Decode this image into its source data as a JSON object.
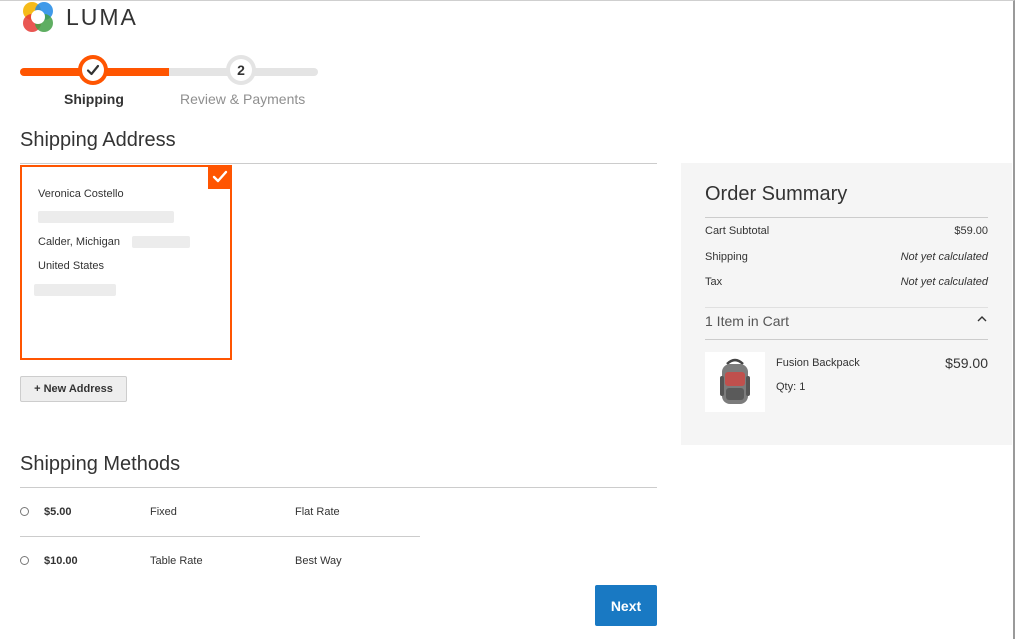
{
  "brand": {
    "name": "LUMA"
  },
  "progress": {
    "steps": [
      {
        "label": "Shipping",
        "number": "1",
        "state": "complete"
      },
      {
        "label": "Review & Payments",
        "number": "2",
        "state": "pending"
      }
    ],
    "completed_fraction": 0.5
  },
  "shipping_address": {
    "title": "Shipping Address",
    "selected_card": {
      "name": "Veronica Costello",
      "street": "",
      "city_line": "Calder, Michigan",
      "country": "United States",
      "phone": ""
    },
    "new_address_label": "+ New Address"
  },
  "shipping_methods": {
    "title": "Shipping Methods",
    "options": [
      {
        "price": "$5.00",
        "carrier": "Fixed",
        "method": "Flat Rate",
        "selected": false
      },
      {
        "price": "$10.00",
        "carrier": "Table Rate",
        "method": "Best Way",
        "selected": false
      }
    ],
    "next_label": "Next"
  },
  "order_summary": {
    "title": "Order Summary",
    "totals": [
      {
        "label": "Cart Subtotal",
        "value": "$59.00"
      },
      {
        "label": "Shipping",
        "value": "Not yet calculated"
      },
      {
        "label": "Tax",
        "value": "Not yet calculated"
      }
    ],
    "items_toggle_label": "1 Item in Cart",
    "items": [
      {
        "name": "Fusion Backpack",
        "qty_label": "Qty: 1",
        "price": "$59.00"
      }
    ]
  },
  "colors": {
    "accent": "#ff5501",
    "primary_button": "#1979c3",
    "summary_bg": "#f5f5f5"
  }
}
